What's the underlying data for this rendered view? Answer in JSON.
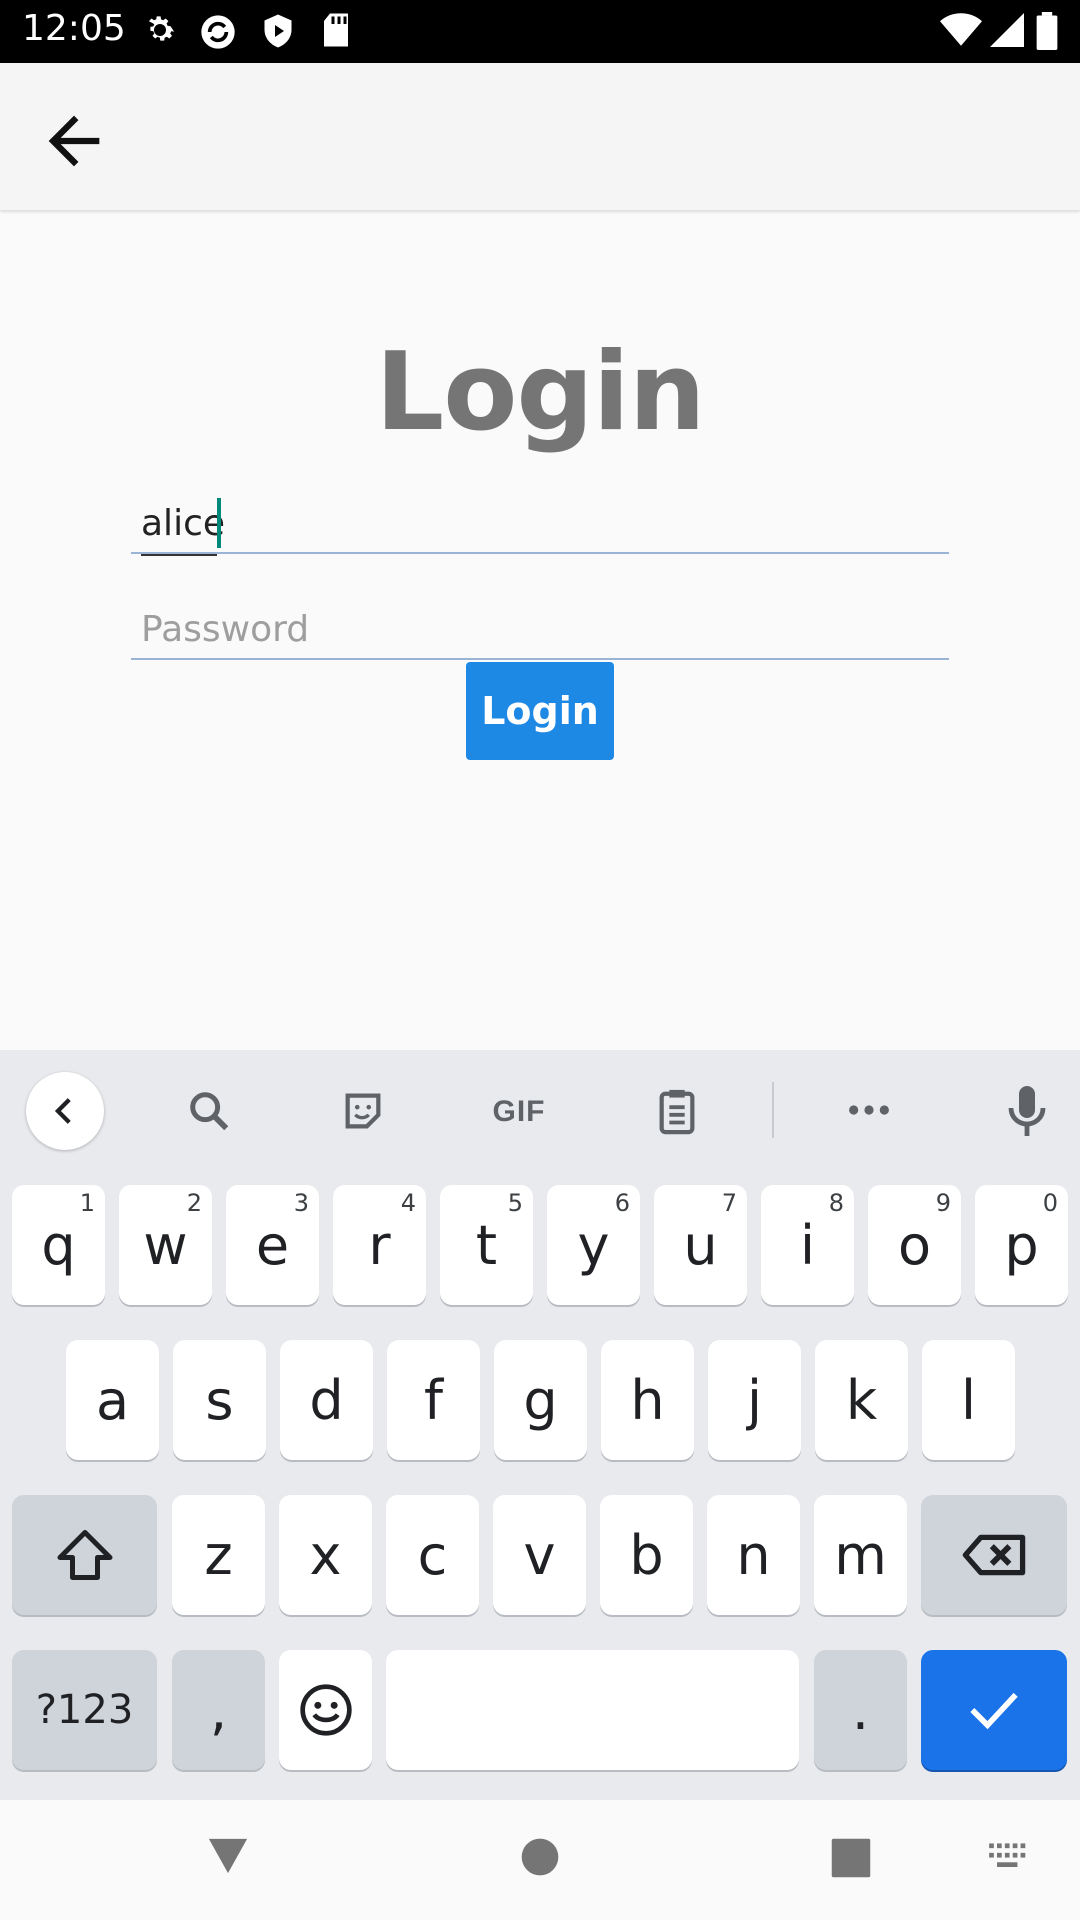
{
  "status_bar": {
    "time": "12:05"
  },
  "login": {
    "title": "Login",
    "username_value": "alice",
    "password_placeholder": "Password",
    "login_button": "Login"
  },
  "keyboard": {
    "toolbar": {
      "gif_label": "GIF"
    },
    "row1": [
      {
        "k": "q",
        "h": "1"
      },
      {
        "k": "w",
        "h": "2"
      },
      {
        "k": "e",
        "h": "3"
      },
      {
        "k": "r",
        "h": "4"
      },
      {
        "k": "t",
        "h": "5"
      },
      {
        "k": "y",
        "h": "6"
      },
      {
        "k": "u",
        "h": "7"
      },
      {
        "k": "i",
        "h": "8"
      },
      {
        "k": "o",
        "h": "9"
      },
      {
        "k": "p",
        "h": "0"
      }
    ],
    "row2": [
      "a",
      "s",
      "d",
      "f",
      "g",
      "h",
      "j",
      "k",
      "l"
    ],
    "row3": [
      "z",
      "x",
      "c",
      "v",
      "b",
      "n",
      "m"
    ],
    "symbols_key": "?123",
    "comma_key": ",",
    "period_key": "."
  }
}
